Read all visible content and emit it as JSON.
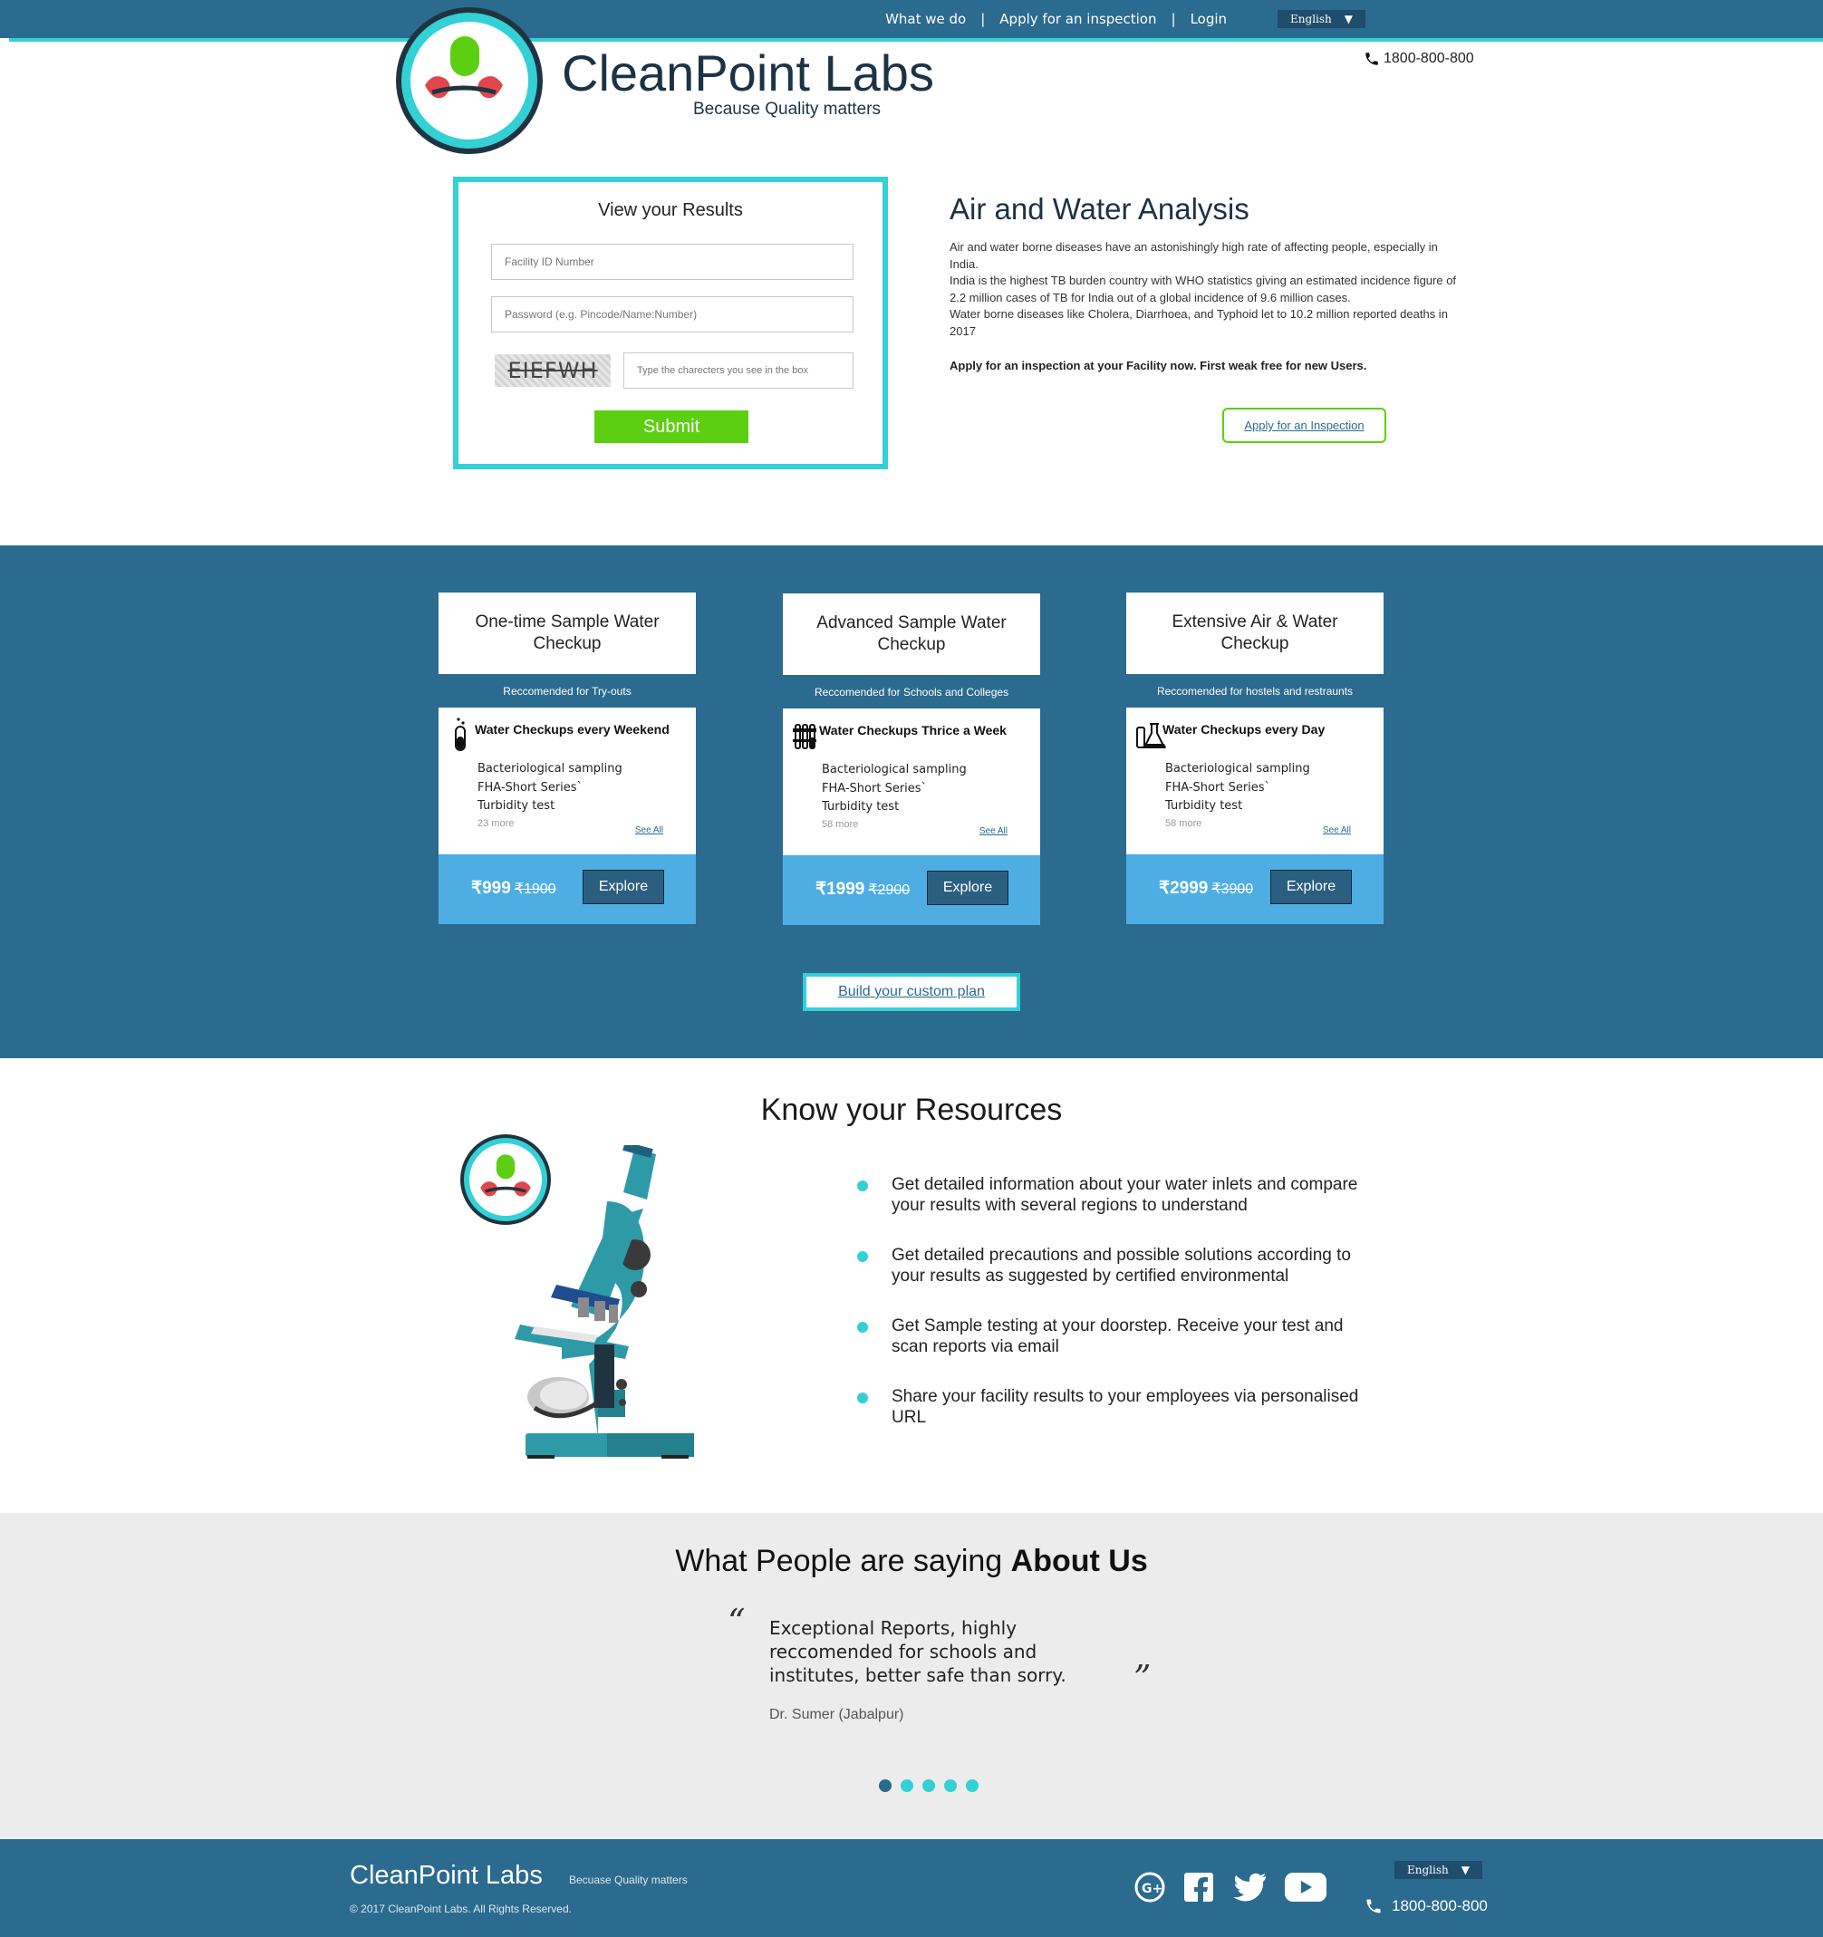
{
  "nav": {
    "links": [
      "What we do",
      "Apply for an inspection",
      "Login"
    ],
    "separator": "|",
    "language": "English",
    "language_caret": "▼"
  },
  "header": {
    "brand": "CleanPoint Labs",
    "tagline": "Because Quality matters",
    "phone": "1800-800-800"
  },
  "login": {
    "title": "View your Results",
    "facility_placeholder": "Facility ID Number",
    "password_placeholder": "Password (e.g. Pincode/Name:Number)",
    "captcha_text": "EIEFWH",
    "captcha_placeholder": "Type the charecters you see in the box",
    "submit_label": "Submit"
  },
  "analysis": {
    "title": "Air and Water Analysis",
    "paragraphs": [
      "Air and water borne diseases have an astonishingly high rate of affecting people, especially in India.",
      "India is the highest TB burden country with WHO statistics giving an estimated incidence figure of 2.2 million cases of TB for India out of a global incidence of 9.6 million cases.",
      "Water borne diseases like Cholera, Diarrhoea, and Typhoid let to 10.2 million reported deaths in 2017"
    ],
    "cta_text": "Apply for an inspection at your Facility now. First weak free for new Users.",
    "apply_button": "Apply for an Inspection"
  },
  "plans": [
    {
      "name": "One-time Sample Water Checkup",
      "recommended": "Reccomended for Try-outs",
      "frequency": "Water Checkups every Weekend",
      "icon": "test-tube-icon",
      "tests": [
        "Bacteriological sampling",
        "FHA-Short Series`",
        "Turbidity test"
      ],
      "more": "23 more",
      "see_all": "See All",
      "price": "₹999",
      "old_price": "₹1900",
      "explore": "Explore"
    },
    {
      "name": "Advanced Sample Water Checkup",
      "recommended": "Reccomended for Schools and Colleges",
      "frequency": "Water Checkups Thrice a Week",
      "icon": "test-tubes-rack-icon",
      "tests": [
        "Bacteriological sampling",
        "FHA-Short Series`",
        "Turbidity test"
      ],
      "more": "58 more",
      "see_all": "See All",
      "price": "₹1999",
      "old_price": "₹2900",
      "explore": "Explore"
    },
    {
      "name": "Extensive Air & Water Checkup",
      "recommended": "Reccomended for hostels and restraunts",
      "frequency": "Water Checkups every Day",
      "icon": "flask-icon",
      "tests": [
        "Bacteriological sampling",
        "FHA-Short Series`",
        "Turbidity test"
      ],
      "more": "58 more",
      "see_all": "See All",
      "price": "₹2999",
      "old_price": "₹3900",
      "explore": "Explore"
    }
  ],
  "custom_plan_label": "Build your custom plan",
  "resources": {
    "title": "Know your Resources",
    "items": [
      "Get detailed information about your water inlets and compare your results with several regions to understand",
      "Get detailed precautions and possible solutions according to your results as suggested by certified environmental",
      "Get Sample testing at your doorstep. Receive your test and scan reports via email",
      "Share your facility results to your employees via personalised URL"
    ]
  },
  "testimonials": {
    "title_prefix": "What People are saying ",
    "title_bold": "About Us",
    "quote_open": "“",
    "quote_close": "”",
    "quote": "Exceptional Reports, highly reccomended for schools and institutes, better safe than sorry.",
    "author": "Dr. Sumer (Jabalpur)",
    "slides": 5,
    "active_slide": 1
  },
  "footer": {
    "brand": "CleanPoint Labs",
    "tagline": "Becuase Quality matters",
    "copyright": "© 2017 CleanPoint Labs. All Rights Reserved.",
    "language": "English",
    "language_caret": "▼",
    "phone": "1800-800-800",
    "socials": [
      "google-plus-icon",
      "facebook-icon",
      "twitter-icon",
      "youtube-icon"
    ]
  },
  "colors": {
    "primary": "#2b6b8f",
    "accent": "#33d0d6",
    "green": "#5dcf12",
    "price_bar": "#4eaee4",
    "logo_red": "#e0474c"
  }
}
